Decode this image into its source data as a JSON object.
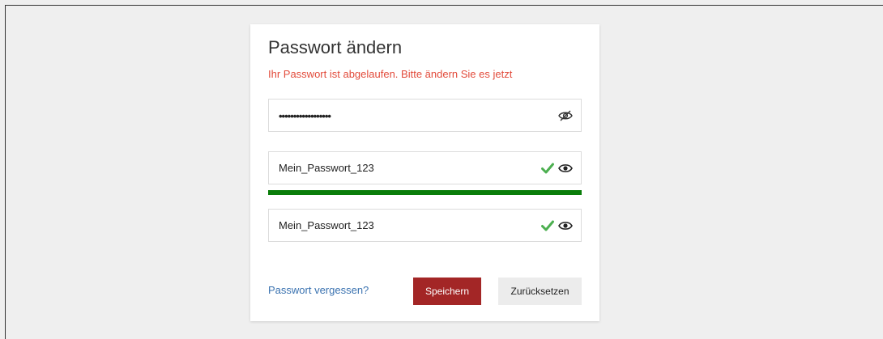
{
  "dialog": {
    "title": "Passwort ändern",
    "error_message": "Ihr Passwort ist abgelaufen. Bitte ändern Sie es jetzt"
  },
  "fields": {
    "current_password": {
      "masked_value": "••••••••••••••••••",
      "toggle_icon": "eye-slash-icon"
    },
    "new_password": {
      "value": "Mein_Passwort_123",
      "status_icon": "check-icon",
      "toggle_icon": "eye-icon"
    },
    "confirm_password": {
      "value": "Mein_Passwort_123",
      "status_icon": "check-icon",
      "toggle_icon": "eye-icon"
    }
  },
  "strength": {
    "level": 1.0,
    "color": "#0a7d0a"
  },
  "links": {
    "forgot_password": "Passwort vergessen?"
  },
  "buttons": {
    "save": "Speichern",
    "reset": "Zurücksetzen"
  },
  "colors": {
    "error": "#e24b3b",
    "primary_button": "#a32626",
    "link": "#3a72b0",
    "check": "#4caf50"
  }
}
